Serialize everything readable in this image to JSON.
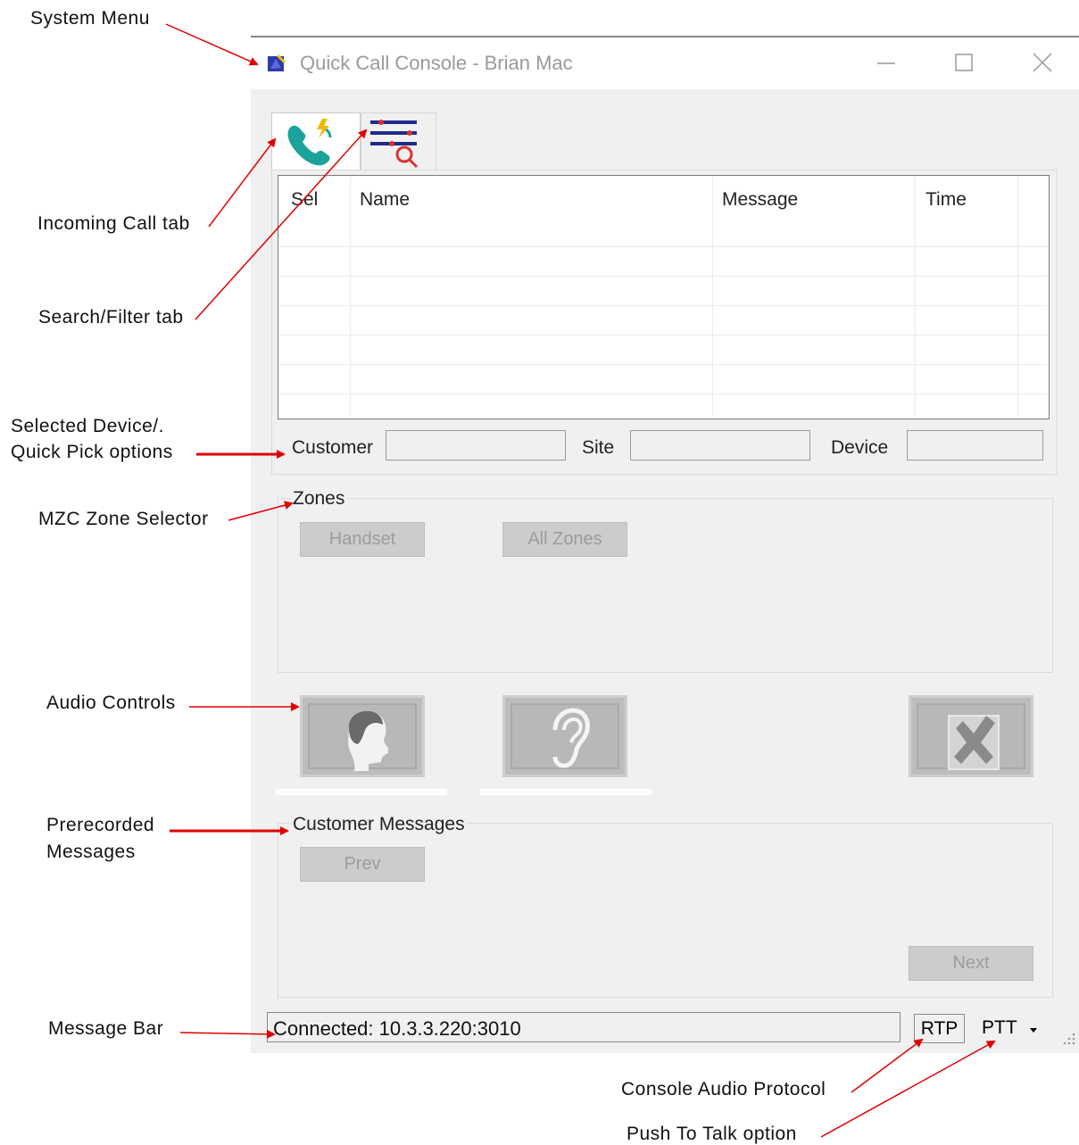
{
  "window": {
    "title": "Quick Call Console - Brian Mac",
    "controls": [
      "minimize-icon",
      "maximize-icon",
      "close-icon"
    ]
  },
  "tabs": [
    {
      "icon": "incoming-call-icon",
      "active": true
    },
    {
      "icon": "search-filter-icon",
      "active": false
    }
  ],
  "grid": {
    "columns": [
      "Sel",
      "Name",
      "Message",
      "Time"
    ],
    "rows": []
  },
  "selection": {
    "customer_label": "Customer",
    "site_label": "Site",
    "device_label": "Device",
    "customer_value": "",
    "site_value": "",
    "device_value": ""
  },
  "zones": {
    "title": "Zones",
    "buttons": [
      "Handset",
      "All Zones"
    ]
  },
  "audio": {
    "buttons": [
      "talk-head-icon",
      "listen-ear-icon",
      "cancel-x-icon"
    ]
  },
  "messages": {
    "title": "Customer Messages",
    "prev_label": "Prev",
    "next_label": "Next"
  },
  "statusbar": {
    "message": "Connected: 10.3.3.220:3010",
    "protocol": "RTP",
    "ptt": "PTT"
  },
  "annotations": {
    "system_menu": "System Menu",
    "incoming_call_tab": "Incoming Call tab",
    "search_filter_tab": "Search/Filter tab",
    "selected_device_line1": "Selected Device/.",
    "selected_device_line2": "Quick Pick options",
    "mzc_zone_selector": "MZC Zone Selector",
    "audio_controls": "Audio Controls",
    "prerecorded_line1": "Prerecorded",
    "prerecorded_line2": "Messages",
    "message_bar": "Message Bar",
    "console_audio_protocol": "Console Audio Protocol",
    "push_to_talk": "Push To Talk option"
  },
  "colors": {
    "arrow": "#e00000",
    "window_bg": "#f0f0f0",
    "disabled_button": "#cccccc",
    "teal_icon": "#1aa39a",
    "navy_icon": "#1f2a8a"
  }
}
